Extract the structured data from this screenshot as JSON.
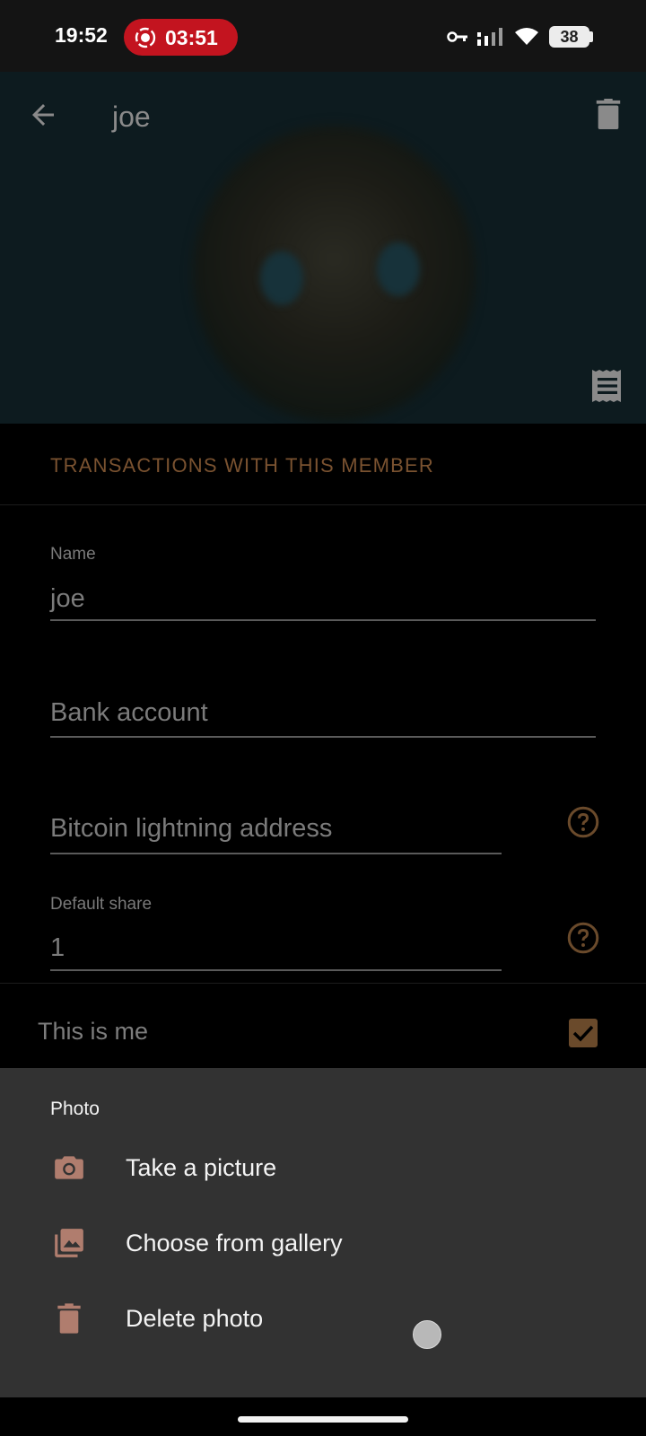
{
  "status_bar": {
    "time": "19:52",
    "recording_time": "03:51",
    "battery": "38",
    "icons": [
      "vpn-key-icon",
      "signal-icon",
      "wifi-icon",
      "battery-icon"
    ],
    "recording_color": "#c3141f"
  },
  "header": {
    "title": "joe",
    "back_icon": "arrow-back-icon",
    "delete_icon": "trash-icon",
    "receipt_icon": "receipt-icon"
  },
  "transactions": {
    "label": "TRANSACTIONS WITH THIS MEMBER",
    "color": "#7a5230"
  },
  "form": {
    "name": {
      "label": "Name",
      "value": "joe"
    },
    "bank_account": {
      "placeholder": "Bank account"
    },
    "lightning": {
      "placeholder": "Bitcoin lightning address"
    },
    "default_share": {
      "label": "Default share",
      "value": "1"
    }
  },
  "this_is_me": {
    "label": "This is me",
    "checked": true
  },
  "photo_sheet": {
    "title": "Photo",
    "items": [
      {
        "label": "Take a picture",
        "icon": "camera-icon"
      },
      {
        "label": "Choose from gallery",
        "icon": "gallery-icon"
      },
      {
        "label": "Delete photo",
        "icon": "trash-icon"
      }
    ],
    "icon_color": "#b07d6e"
  }
}
